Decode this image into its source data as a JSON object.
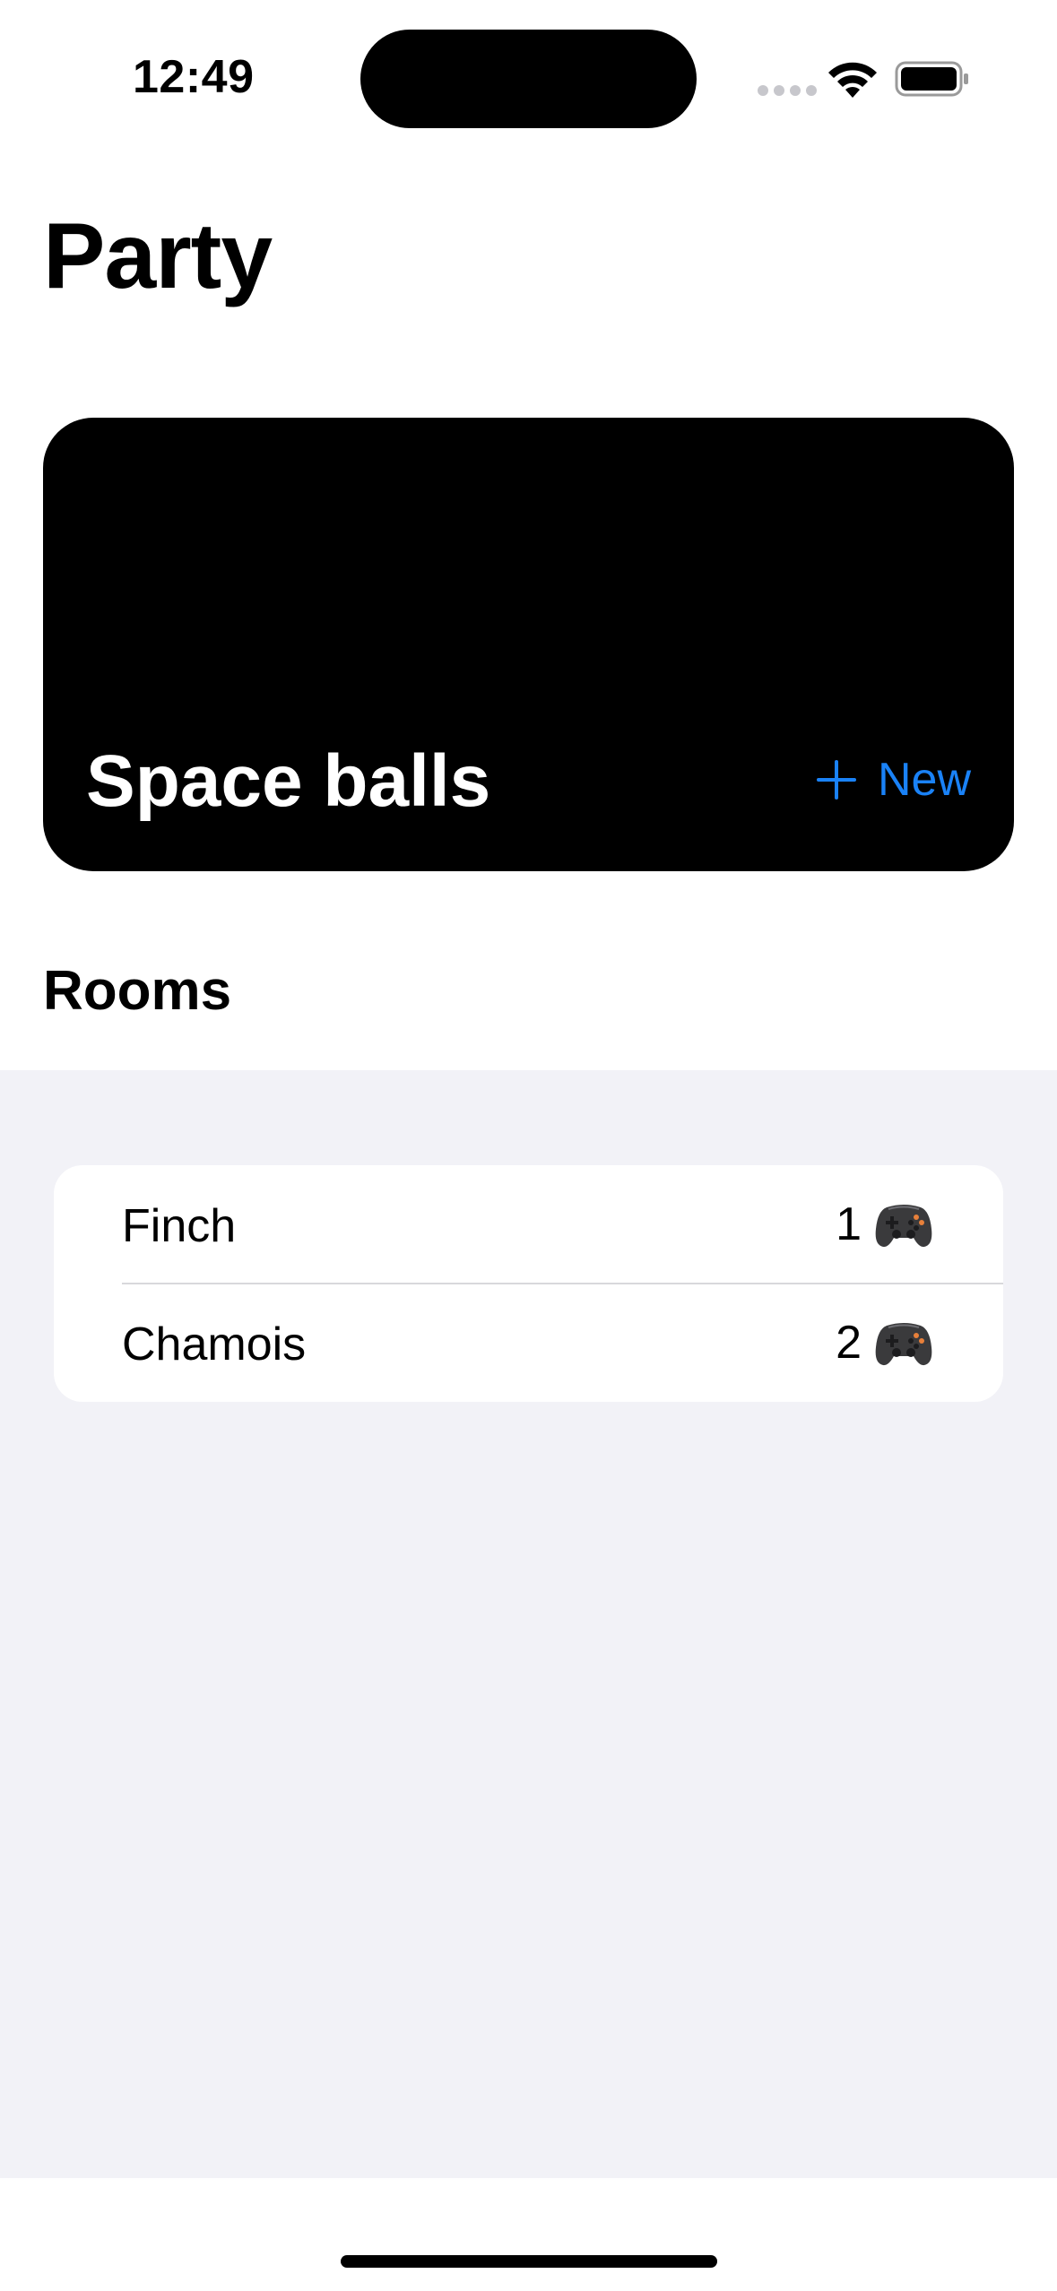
{
  "status_bar": {
    "time": "12:49"
  },
  "page": {
    "title": "Party"
  },
  "party_card": {
    "name": "Space balls",
    "new_label": "New",
    "accent_color": "#1a82f7"
  },
  "rooms_section": {
    "header": "Rooms",
    "rooms": [
      {
        "name": "Finch",
        "count": "1"
      },
      {
        "name": "Chamois",
        "count": "2"
      }
    ]
  },
  "icons": {
    "wifi": "wifi-icon",
    "battery": "battery-icon",
    "plus": "plus-icon",
    "gamepad": "gamepad-icon"
  }
}
